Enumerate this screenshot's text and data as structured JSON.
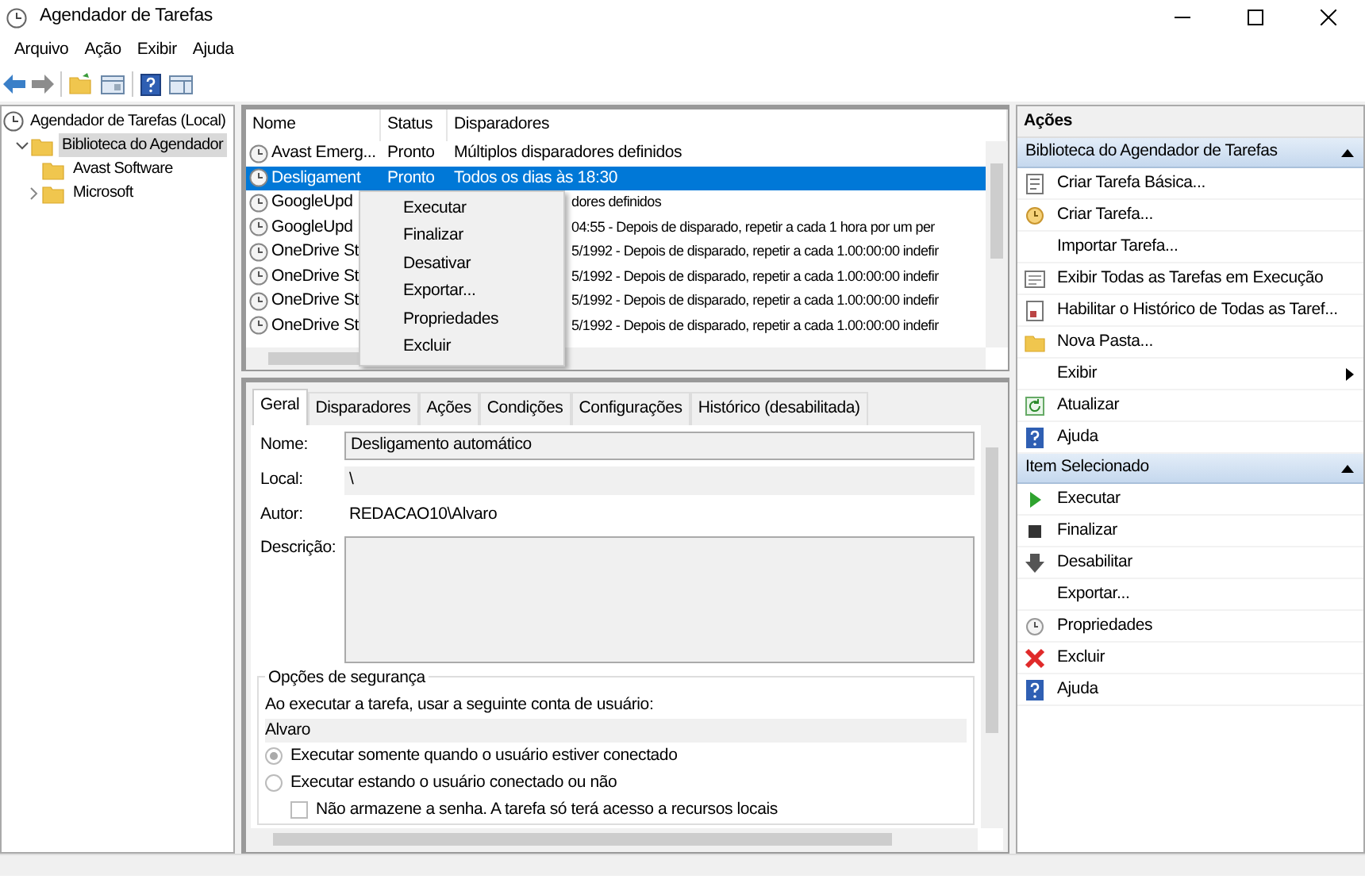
{
  "window": {
    "title": "Agendador de Tarefas"
  },
  "menu": [
    "Arquivo",
    "Ação",
    "Exibir",
    "Ajuda"
  ],
  "tree": [
    {
      "label": "Agendador de Tarefas (Local)",
      "selected": false,
      "children": [
        {
          "label": "Biblioteca do Agendador",
          "selected": true,
          "expanded": true,
          "children": [
            {
              "label": "Avast Software",
              "selected": false
            },
            {
              "label": "Microsoft",
              "selected": false,
              "expanded": false
            }
          ]
        }
      ]
    }
  ],
  "task_table": {
    "columns": [
      "Nome",
      "Status",
      "Disparadores"
    ],
    "rows": [
      {
        "name": "Avast Emerg...",
        "status": "Pronto",
        "trigger": "Múltiplos disparadores definidos",
        "selected": false,
        "covered": false
      },
      {
        "name": "Desligament",
        "status": "Pronto",
        "trigger": "Todos os dias às 18:30",
        "selected": true,
        "covered": false
      },
      {
        "name": "GoogleUpd",
        "trigger": "dores definidos",
        "selected": false,
        "covered": true
      },
      {
        "name": "GoogleUpd",
        "trigger": "04:55 - Depois de disparado, repetir a cada 1 hora por um per",
        "selected": false,
        "covered": true
      },
      {
        "name": "OneDrive St",
        "trigger": "5/1992 - Depois de disparado, repetir a cada 1.00:00:00 indefir",
        "selected": false,
        "covered": true
      },
      {
        "name": "OneDrive St",
        "trigger": "5/1992 - Depois de disparado, repetir a cada 1.00:00:00 indefir",
        "selected": false,
        "covered": true
      },
      {
        "name": "OneDrive St",
        "trigger": "5/1992 - Depois de disparado, repetir a cada 1.00:00:00 indefir",
        "selected": false,
        "covered": true
      },
      {
        "name": "OneDrive St",
        "trigger": "5/1992 - Depois de disparado, repetir a cada 1.00:00:00 indefir",
        "selected": false,
        "covered": true
      }
    ]
  },
  "context_menu": [
    "Executar",
    "Finalizar",
    "Desativar",
    "Exportar...",
    "Propriedades",
    "Excluir"
  ],
  "detail_tabs": [
    {
      "label": "Geral",
      "selected": true
    },
    {
      "label": "Disparadores",
      "selected": false
    },
    {
      "label": "Ações",
      "selected": false
    },
    {
      "label": "Condições",
      "selected": false
    },
    {
      "label": "Configurações",
      "selected": false
    },
    {
      "label": "Histórico (desabilitada)",
      "selected": false
    }
  ],
  "general": {
    "name_label": "Nome:",
    "name_value": "Desligamento automático",
    "location_label": "Local:",
    "location_value": "\\",
    "author_label": "Autor:",
    "author_value": "REDACAO10\\Alvaro",
    "description_label": "Descrição:",
    "security": {
      "title": "Opções de segurança",
      "account_label": "Ao executar a tarefa, usar a seguinte conta de usuário:",
      "account": "Alvaro",
      "options": [
        {
          "kind": "radio",
          "label": "Executar somente quando o usuário estiver conectado",
          "selected": true
        },
        {
          "kind": "radio",
          "label": "Executar estando o usuário conectado ou não",
          "selected": false
        },
        {
          "kind": "checkbox",
          "label": "Não armazene a senha. A tarefa só terá acesso a recursos locais",
          "checked": false
        }
      ]
    }
  },
  "actions": {
    "title": "Ações",
    "sections": [
      {
        "title": "Biblioteca do Agendador de Tarefas",
        "expanded": true,
        "items": [
          {
            "kind": "action",
            "label": "Criar Tarefa Básica..."
          },
          {
            "kind": "action",
            "label": "Criar Tarefa..."
          },
          {
            "kind": "action",
            "label": "Importar Tarefa..."
          },
          {
            "kind": "action",
            "label": "Exibir Todas as Tarefas em Execução"
          },
          {
            "kind": "action",
            "label": "Habilitar o Histórico de Todas as Taref..."
          },
          {
            "kind": "action",
            "label": "Nova Pasta..."
          },
          {
            "kind": "submenu",
            "label": "Exibir"
          },
          {
            "kind": "action",
            "label": "Atualizar"
          },
          {
            "kind": "action",
            "label": "Ajuda"
          }
        ]
      },
      {
        "title": "Item Selecionado",
        "expanded": true,
        "items": [
          {
            "kind": "action",
            "label": "Executar"
          },
          {
            "kind": "action",
            "label": "Finalizar"
          },
          {
            "kind": "action",
            "label": "Desabilitar"
          },
          {
            "kind": "action",
            "label": "Exportar..."
          },
          {
            "kind": "action",
            "label": "Propriedades"
          },
          {
            "kind": "action",
            "label": "Excluir"
          },
          {
            "kind": "action",
            "label": "Ajuda"
          }
        ]
      }
    ]
  }
}
